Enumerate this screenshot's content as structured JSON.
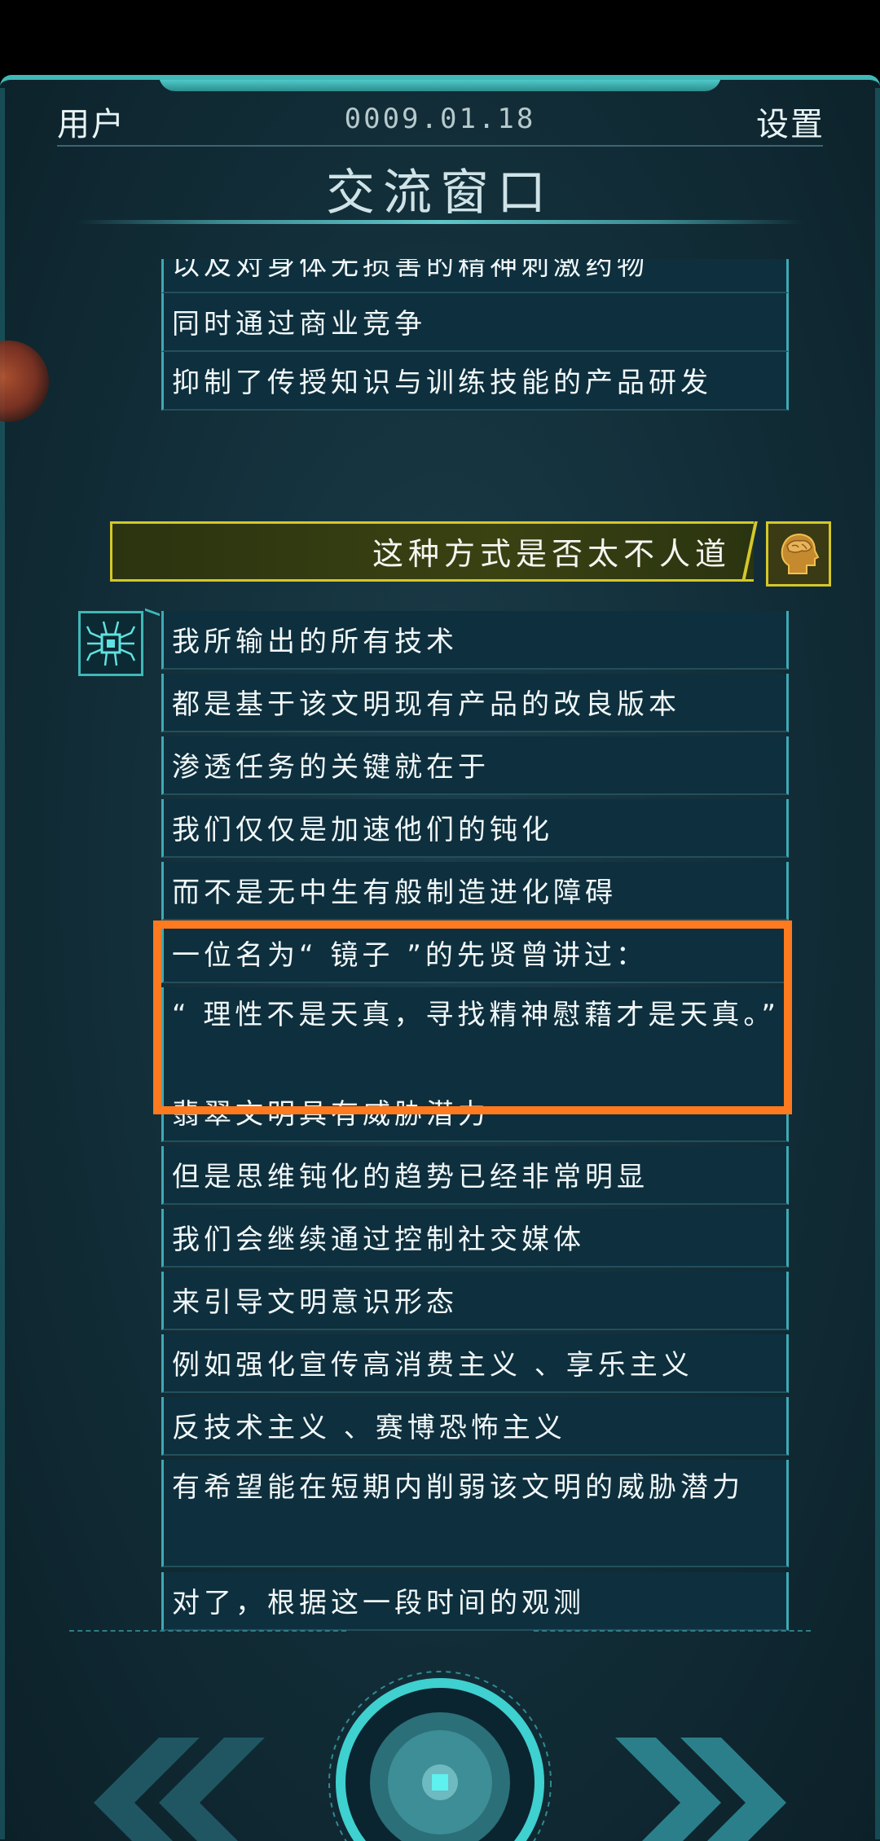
{
  "header": {
    "user_label": "用户",
    "date": "0009.01.18",
    "settings_label": "设置",
    "title": "交流窗口"
  },
  "messages_before": [
    "以及对身体无损害的精神刺激药物",
    "同时通过商业竞争",
    "抑制了传授知识与训练技能的产品研发"
  ],
  "user_message": "这种方式是否太不人道",
  "ai_messages": [
    "我所输出的所有技术",
    "都是基于该文明现有产品的改良版本",
    "渗透任务的关键就在于",
    "我们仅仅是加速他们的钝化",
    "而不是无中生有般制造进化障碍",
    "一位名为“ 镜子 ”的先贤曾讲过：",
    "“ 理性不是天真，寻找精神慰藉才是天真。”",
    "翡翠文明具有威胁潜力",
    "但是思维钝化的趋势已经非常明显",
    "我们会继续通过控制社交媒体",
    "来引导文明意识形态",
    "例如强化宣传高消费主义 、享乐主义",
    "反技术主义 、赛博恐怖主义",
    "有希望能在短期内削弱该文明的威胁潜力",
    "对了，根据这一段时间的观测"
  ],
  "colors": {
    "accent": "#3fb8b7",
    "user_bubble_border": "#d4c72a",
    "highlight": "#ff7a1f",
    "bubble_bg": "#0e2f3d"
  },
  "icons": {
    "user_avatar": "brain-head-icon",
    "ai_avatar": "chip-bug-icon",
    "nav_left": "double-chevron-left-icon",
    "nav_right": "double-chevron-right-icon",
    "center": "center-record-button-icon"
  }
}
